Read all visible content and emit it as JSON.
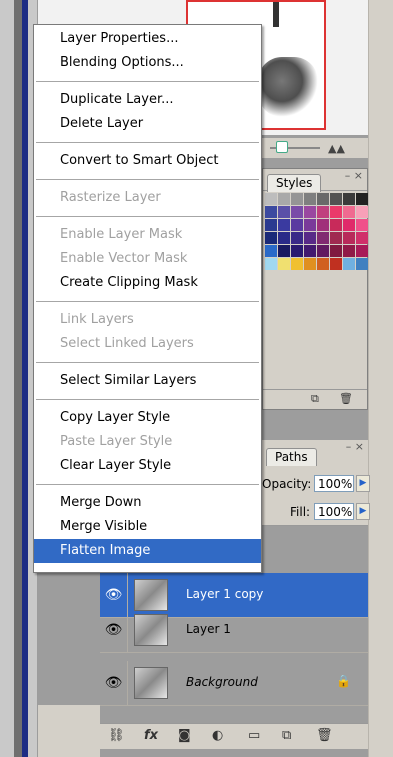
{
  "context_menu": {
    "groups": [
      [
        {
          "label": "Layer Properties...",
          "enabled": true
        },
        {
          "label": "Blending Options...",
          "enabled": true
        }
      ],
      [
        {
          "label": "Duplicate Layer...",
          "enabled": true
        },
        {
          "label": "Delete Layer",
          "enabled": true
        }
      ],
      [
        {
          "label": "Convert to Smart Object",
          "enabled": true
        }
      ],
      [
        {
          "label": "Rasterize Layer",
          "enabled": false
        }
      ],
      [
        {
          "label": "Enable Layer Mask",
          "enabled": false
        },
        {
          "label": "Enable Vector Mask",
          "enabled": false
        },
        {
          "label": "Create Clipping Mask",
          "enabled": true
        }
      ],
      [
        {
          "label": "Link Layers",
          "enabled": false
        },
        {
          "label": "Select Linked Layers",
          "enabled": false
        }
      ],
      [
        {
          "label": "Select Similar Layers",
          "enabled": true
        }
      ],
      [
        {
          "label": "Copy Layer Style",
          "enabled": true
        },
        {
          "label": "Paste Layer Style",
          "enabled": false
        },
        {
          "label": "Clear Layer Style",
          "enabled": true
        }
      ],
      [
        {
          "label": "Merge Down",
          "enabled": true
        },
        {
          "label": "Merge Visible",
          "enabled": true
        },
        {
          "label": "Flatten Image",
          "enabled": true,
          "selected": true
        }
      ]
    ]
  },
  "swatches_panel": {
    "tab_label": "Styles",
    "colors": [
      "#bdbdbd",
      "#a9a9a9",
      "#959595",
      "#7f7f7f",
      "#696969",
      "#525252",
      "#3a3a3a",
      "#222222",
      "#3c4aa0",
      "#5a50a8",
      "#7a4ca8",
      "#9a48a0",
      "#c0407e",
      "#ea3a6a",
      "#f06a90",
      "#f8a0b8",
      "#2a3a90",
      "#3a3aa0",
      "#5a3aa0",
      "#7a3a9a",
      "#a0307a",
      "#c82a5a",
      "#e02a6a",
      "#f0508a",
      "#1a2a78",
      "#2a2a88",
      "#3a2a88",
      "#582a88",
      "#802a70",
      "#a02a50",
      "#b82a5a",
      "#d0306a",
      "#2a6ac8",
      "#1a1a60",
      "#2a1a70",
      "#421a70",
      "#601a60",
      "#801a40",
      "#901a48",
      "#a81a58",
      "#a0d8f0",
      "#f0e070",
      "#f0c030",
      "#e09020",
      "#d06020",
      "#c03020",
      "#70b0e0",
      "#4080c0"
    ]
  },
  "layers_panel": {
    "tab_label": "Paths",
    "opacity_label": "Opacity:",
    "opacity_value": "100%",
    "fill_label": "Fill:",
    "fill_value": "100%",
    "layers": [
      {
        "name": "Layer 1 copy",
        "selected": true
      },
      {
        "name": "Layer 1",
        "selected": false
      },
      {
        "name": "Background",
        "selected": false,
        "locked": true
      }
    ]
  }
}
